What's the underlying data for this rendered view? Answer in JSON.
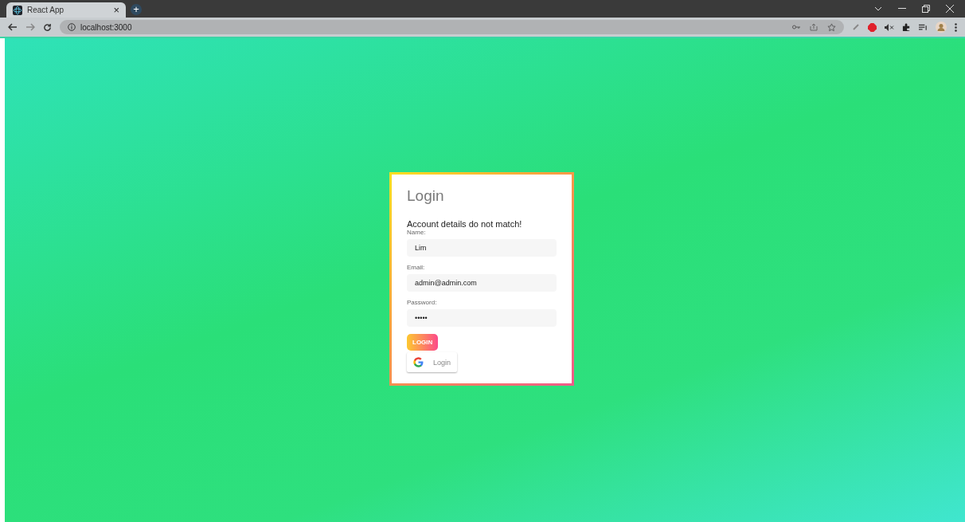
{
  "browser": {
    "tab_title": "React App",
    "tab_close": "×",
    "new_tab": "+",
    "url": "localhost:3000"
  },
  "login": {
    "title": "Login",
    "error": "Account details do not match!",
    "fields": [
      {
        "label": "Name:",
        "value": "Lim"
      },
      {
        "label": "Email:",
        "value": "admin@admin.com"
      },
      {
        "label": "Password:",
        "value": "•••••"
      }
    ],
    "submit": "LOGIN",
    "google": "Login"
  }
}
